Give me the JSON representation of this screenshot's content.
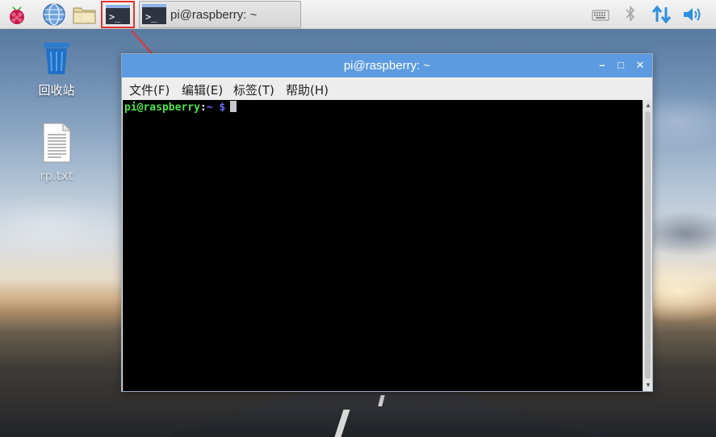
{
  "taskbar": {
    "launchers": [
      "raspberry-menu",
      "web-browser",
      "file-manager",
      "terminal"
    ],
    "terminal_glyph": ">_",
    "task_button": {
      "label": "pi@raspberry: ~"
    },
    "tray": [
      "keyboard",
      "bluetooth",
      "network",
      "volume"
    ]
  },
  "desktop": {
    "icons": [
      {
        "label": "回收站",
        "icon": "trash-icon"
      },
      {
        "label": "rp.txt",
        "icon": "text-file-icon"
      }
    ]
  },
  "window": {
    "title": "pi@raspberry: ~",
    "controls": {
      "minimize": "–",
      "maximize": "□",
      "close": "✕"
    },
    "menu": [
      "文件(F)",
      "编辑(E)",
      "标签(T)",
      "帮助(H)"
    ],
    "terminal": {
      "user_host": "pi@raspberry",
      "separator": ":",
      "path": "~ $"
    }
  },
  "colors": {
    "highlight": "#e3342f",
    "titlebar": "#5c9be0",
    "prompt_user": "#4ee44e",
    "prompt_path": "#6a6aff"
  }
}
